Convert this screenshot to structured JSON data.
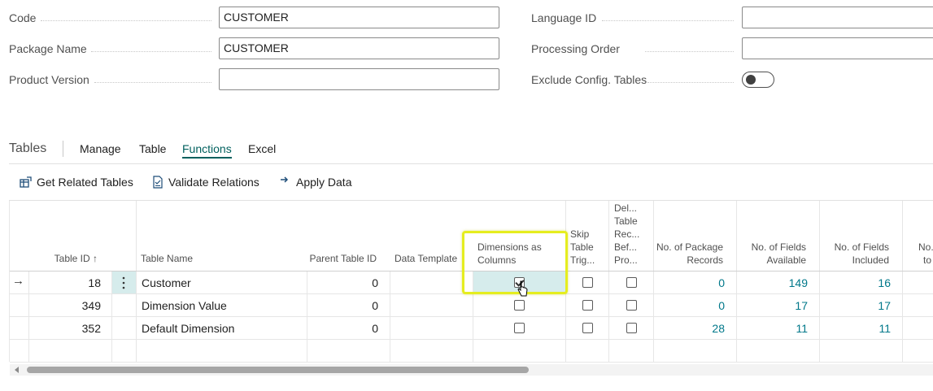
{
  "fields": {
    "code": {
      "label": "Code",
      "value": "CUSTOMER"
    },
    "package_name": {
      "label": "Package Name",
      "value": "CUSTOMER"
    },
    "product_version": {
      "label": "Product Version",
      "value": ""
    },
    "language_id": {
      "label": "Language ID",
      "value": ""
    },
    "processing_order": {
      "label": "Processing Order",
      "value": ""
    },
    "exclude_config_tables": {
      "label": "Exclude Config. Tables",
      "on": false
    }
  },
  "tabs": {
    "title": "Tables",
    "items": [
      "Manage",
      "Table",
      "Functions",
      "Excel"
    ],
    "active": "Functions"
  },
  "actions": {
    "get_related": "Get Related Tables",
    "validate": "Validate Relations",
    "apply": "Apply Data"
  },
  "columns": {
    "table_id": "Table ID ↑",
    "table_name": "Table Name",
    "parent_table_id": "Parent Table ID",
    "data_template": "Data Template",
    "dimensions_as_columns": [
      "Dimensions as",
      "Columns"
    ],
    "skip_table_trig": [
      "Skip",
      "Table",
      "Trig..."
    ],
    "delete_table_rec": [
      "Del...",
      "Table",
      "Rec...",
      "Bef...",
      "Pro..."
    ],
    "no_package_records": [
      "No. of Package",
      "Records"
    ],
    "no_fields_available": [
      "No. of Fields",
      "Available"
    ],
    "no_fields_included": [
      "No. of Fields",
      "Included"
    ],
    "no_partial": [
      "No.",
      "to"
    ]
  },
  "rows": [
    {
      "table_id": "18",
      "table_name": "Customer",
      "parent_table_id": "0",
      "data_template": "",
      "dimensions_as_columns": true,
      "skip_table_trig": false,
      "delete_table_rec": false,
      "no_package_records": "0",
      "no_fields_available": "149",
      "no_fields_included": "16"
    },
    {
      "table_id": "349",
      "table_name": "Dimension Value",
      "parent_table_id": "0",
      "data_template": "",
      "dimensions_as_columns": false,
      "skip_table_trig": false,
      "delete_table_rec": false,
      "no_package_records": "0",
      "no_fields_available": "17",
      "no_fields_included": "17"
    },
    {
      "table_id": "352",
      "table_name": "Default Dimension",
      "parent_table_id": "0",
      "data_template": "",
      "dimensions_as_columns": false,
      "skip_table_trig": false,
      "delete_table_rec": false,
      "no_package_records": "28",
      "no_fields_available": "11",
      "no_fields_included": "11"
    }
  ],
  "colors": {
    "accent": "#00605e",
    "link": "#00788a",
    "highlight_border": "#e5ed1f",
    "selected_cell": "#d6ecec"
  }
}
